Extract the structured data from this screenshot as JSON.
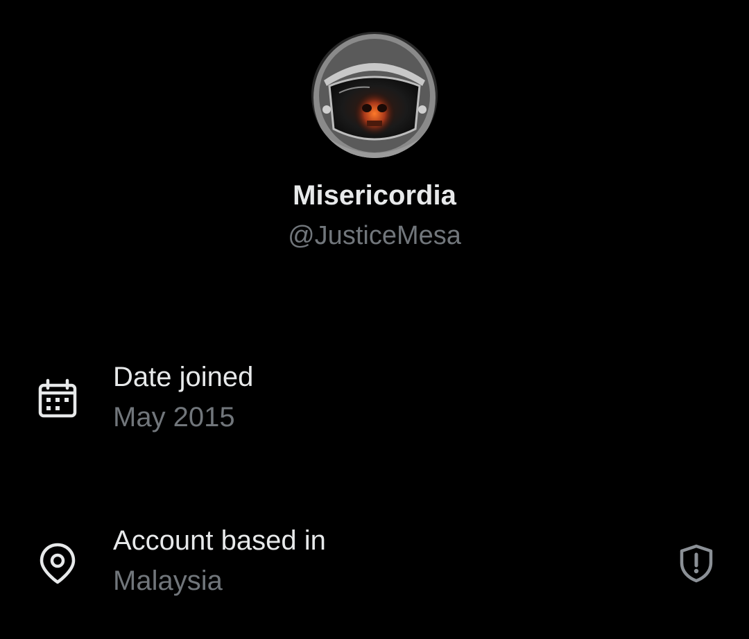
{
  "profile": {
    "display_name": "Misericordia",
    "handle": "@JusticeMesa",
    "avatar_icon": "astronaut-helmet-skull-avatar"
  },
  "details": {
    "joined": {
      "label": "Date joined",
      "value": "May 2015",
      "icon": "calendar-icon"
    },
    "location": {
      "label": "Account based in",
      "value": "Malaysia",
      "icon": "location-pin-icon",
      "trailing_icon": "shield-alert-icon"
    }
  },
  "colors": {
    "background": "#000000",
    "primary_text": "#e7e9ea",
    "secondary_text": "#71767b"
  }
}
